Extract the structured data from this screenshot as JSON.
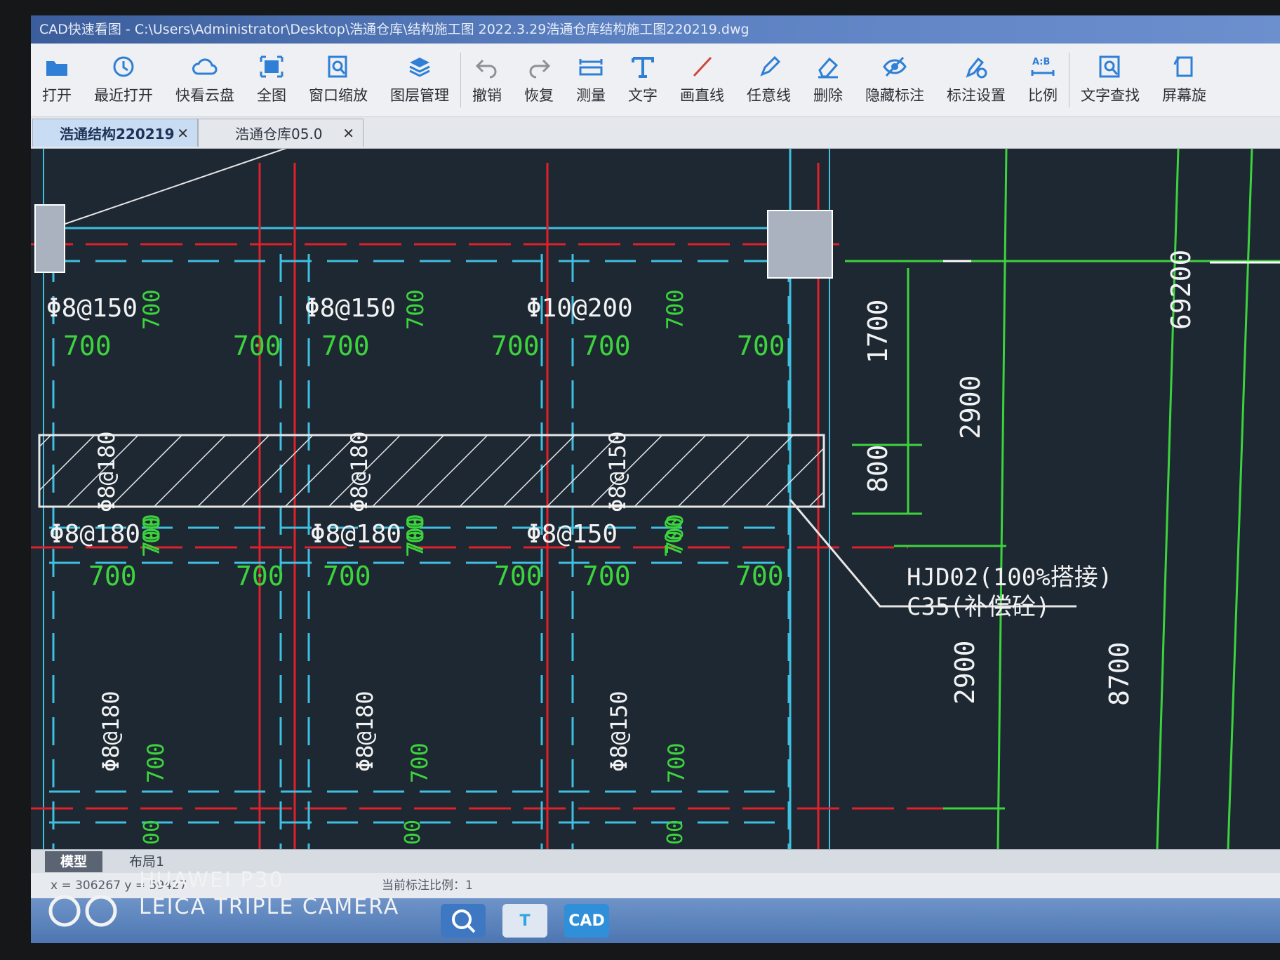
{
  "window": {
    "title": "CAD快速看图 - C:\\Users\\Administrator\\Desktop\\浩通仓库\\结构施工图 2022.3.29浩通仓库结构施工图220219.dwg"
  },
  "toolbar": {
    "items": [
      {
        "label": "打开",
        "icon": "folder-icon",
        "color": "#2f7fd6"
      },
      {
        "label": "最近打开",
        "icon": "clock-icon",
        "color": "#2f7fd6"
      },
      {
        "label": "快看云盘",
        "icon": "cloud-icon",
        "color": "#2f7fd6"
      },
      {
        "label": "全图",
        "icon": "fit-all-icon",
        "color": "#2f7fd6"
      },
      {
        "label": "窗口缩放",
        "icon": "window-zoom-icon",
        "color": "#2f7fd6"
      },
      {
        "label": "图层管理",
        "icon": "layers-icon",
        "color": "#2f7fd6"
      },
      {
        "label": "撤销",
        "icon": "undo-icon",
        "color": "#8c9199"
      },
      {
        "label": "恢复",
        "icon": "redo-icon",
        "color": "#8c9199"
      },
      {
        "label": "测量",
        "icon": "ruler-icon",
        "color": "#2f7fd6"
      },
      {
        "label": "文字",
        "icon": "text-t-icon",
        "color": "#2f7fd6"
      },
      {
        "label": "画直线",
        "icon": "line-icon",
        "color": "#d0463a"
      },
      {
        "label": "任意线",
        "icon": "pen-icon",
        "color": "#2f7fd6"
      },
      {
        "label": "删除",
        "icon": "eraser-icon",
        "color": "#2f7fd6"
      },
      {
        "label": "隐藏标注",
        "icon": "eye-slash-icon",
        "color": "#2f7fd6"
      },
      {
        "label": "标注设置",
        "icon": "pen-gear-icon",
        "color": "#2f7fd6"
      },
      {
        "label": "比例",
        "icon": "ratio-icon",
        "color": "#2f7fd6"
      },
      {
        "label": "文字查找",
        "icon": "find-text-icon",
        "color": "#2f7fd6"
      },
      {
        "label": "屏幕旋",
        "icon": "rotate-screen-icon",
        "color": "#2f7fd6"
      }
    ]
  },
  "tabs": [
    {
      "label": "浩通结构220219",
      "active": true
    },
    {
      "label": "浩通仓库05.0",
      "active": false
    }
  ],
  "drawing": {
    "rebar_top": [
      "Φ8@150",
      "Φ8@150",
      "Φ10@200"
    ],
    "rebar_bottom": [
      "Φ8@180",
      "Φ8@180",
      "Φ8@150"
    ],
    "rebar_vert_mid": [
      "Φ8@180",
      "Φ8@180",
      "Φ8@150"
    ],
    "rebar_vert_low": [
      "Φ8@180",
      "Φ8@180",
      "Φ8@150"
    ],
    "dim_700": "700",
    "dim_1700": "1700",
    "dim_800": "800",
    "dim_2900": "2900",
    "dim_69200": "69200",
    "dim_8700": "8700",
    "dim_00": "00",
    "note_line1": "HJD02(100%搭接)",
    "note_line2": "C35(补偿砼)"
  },
  "layout_tabs": [
    {
      "label": "模型",
      "active": true
    },
    {
      "label": "布局1",
      "active": false
    }
  ],
  "status": {
    "coords": "x = 306267  y = 59427",
    "scale": "当前标注比例：1"
  },
  "watermark": {
    "line1": "HUAWEI P30",
    "line2": "LEICA TRIPLE CAMERA"
  },
  "taskbar": {
    "apps": [
      {
        "label": "T",
        "icon": "text-app-icon",
        "color": "#2fa5e0"
      },
      {
        "label": "CAD",
        "icon": "cad-app-icon",
        "color": "#2f8fd8"
      }
    ]
  }
}
